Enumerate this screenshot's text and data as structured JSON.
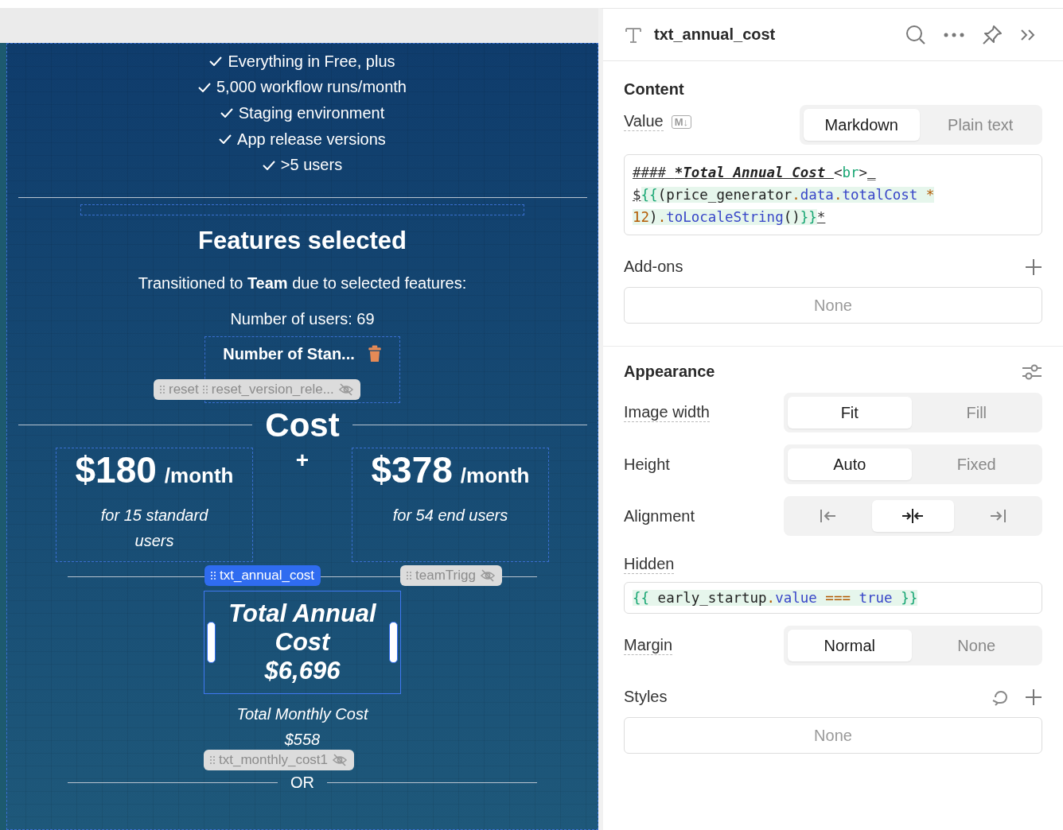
{
  "canvas": {
    "features": [
      "Everything in Free, plus",
      "5,000 workflow runs/month",
      "Staging environment",
      "App release versions",
      ">5 users"
    ],
    "features_heading": "Features selected",
    "transition_text": "Transitioned to **Team** due to selected features:",
    "users_text": "Number of users: 69",
    "selected_field": {
      "label": "Number of Stan..."
    },
    "top_chip": {
      "labels": [
        "reset",
        "reset_version_rele..."
      ],
      "hidden": true
    },
    "cost_heading": "Cost",
    "prices": [
      {
        "amount": "$180",
        "period": "/month",
        "note": "for 15 standard users"
      },
      {
        "amount": "$378",
        "period": "/month",
        "note": "for 54 end users"
      }
    ],
    "plus": "+",
    "chips": [
      {
        "label": "txt_annual_cost",
        "selected": true,
        "hidden": false
      },
      {
        "label": "teamTrigg",
        "selected": false,
        "hidden": true
      }
    ],
    "annual": {
      "lines": [
        "Total Annual",
        "Cost",
        "$6,696"
      ],
      "selected": true
    },
    "monthly": {
      "lines": [
        "Total Monthly Cost",
        "$558"
      ]
    },
    "bottom_chip": {
      "label": "txt_monthly_cost1",
      "selected": false,
      "hidden": true
    },
    "or_divider": "OR"
  },
  "inspector": {
    "title": "txt_annual_cost",
    "content": {
      "heading": "Content",
      "value_label": "Value",
      "md_badge": "M↓",
      "modes": [
        {
          "label": "Markdown",
          "selected": true
        },
        {
          "label": "Plain text",
          "selected": false
        }
      ],
      "code": [
        [
          {
            "text": "#### ",
            "kind": "mark"
          },
          {
            "text": "*Total Annual Cost ",
            "kind": "mark-italic"
          },
          {
            "text": "<",
            "kind": "plain"
          },
          {
            "text": "br",
            "kind": "tag"
          },
          {
            "text": ">",
            "kind": "plain"
          },
          {
            "text": "_",
            "kind": "mark"
          }
        ],
        [
          {
            "text": "$",
            "kind": "mark"
          },
          {
            "text": "{{",
            "kind": "brace"
          },
          {
            "text": "(price_generator",
            "kind": "plain-hl"
          },
          {
            "text": ".",
            "kind": "op"
          },
          {
            "text": "data",
            "kind": "prop"
          },
          {
            "text": ".",
            "kind": "op"
          },
          {
            "text": "totalCost ",
            "kind": "prop"
          },
          {
            "text": "*",
            "kind": "op"
          }
        ],
        [
          {
            "text": "12",
            "kind": "op"
          },
          {
            "text": ")",
            "kind": "plain-hl"
          },
          {
            "text": ".",
            "kind": "op"
          },
          {
            "text": "toLocaleString",
            "kind": "prop"
          },
          {
            "text": "()",
            "kind": "plain-hl"
          },
          {
            "text": "}}",
            "kind": "brace"
          },
          {
            "text": "*",
            "kind": "mark"
          }
        ]
      ],
      "addons_label": "Add-ons",
      "addons_value": "None"
    },
    "appearance": {
      "heading": "Appearance",
      "rows": [
        {
          "kind": "segmented",
          "label": "Image width",
          "dotted": true,
          "options": [
            {
              "label": "Fit",
              "selected": true
            },
            {
              "label": "Fill",
              "selected": false
            }
          ]
        },
        {
          "kind": "segmented",
          "label": "Height",
          "dotted": false,
          "options": [
            {
              "label": "Auto",
              "selected": true
            },
            {
              "label": "Fixed",
              "selected": false
            }
          ]
        },
        {
          "kind": "icons",
          "label": "Alignment",
          "dotted": false,
          "options": [
            {
              "kind": "left",
              "selected": false
            },
            {
              "kind": "center",
              "selected": true
            },
            {
              "kind": "right",
              "selected": false
            }
          ]
        },
        {
          "kind": "code",
          "label": "Hidden",
          "dotted": true,
          "code": [
            {
              "text": "{{ ",
              "kind": "brace"
            },
            {
              "text": "early_startup",
              "kind": "plain-hl"
            },
            {
              "text": ".",
              "kind": "op"
            },
            {
              "text": "value ",
              "kind": "prop"
            },
            {
              "text": "=== ",
              "kind": "op"
            },
            {
              "text": "true ",
              "kind": "prop"
            },
            {
              "text": "}}",
              "kind": "brace"
            }
          ]
        },
        {
          "kind": "segmented",
          "label": "Margin",
          "dotted": true,
          "options": [
            {
              "label": "Normal",
              "selected": true
            },
            {
              "label": "None",
              "selected": false
            }
          ]
        }
      ],
      "styles_label": "Styles",
      "styles_value": "None"
    }
  }
}
